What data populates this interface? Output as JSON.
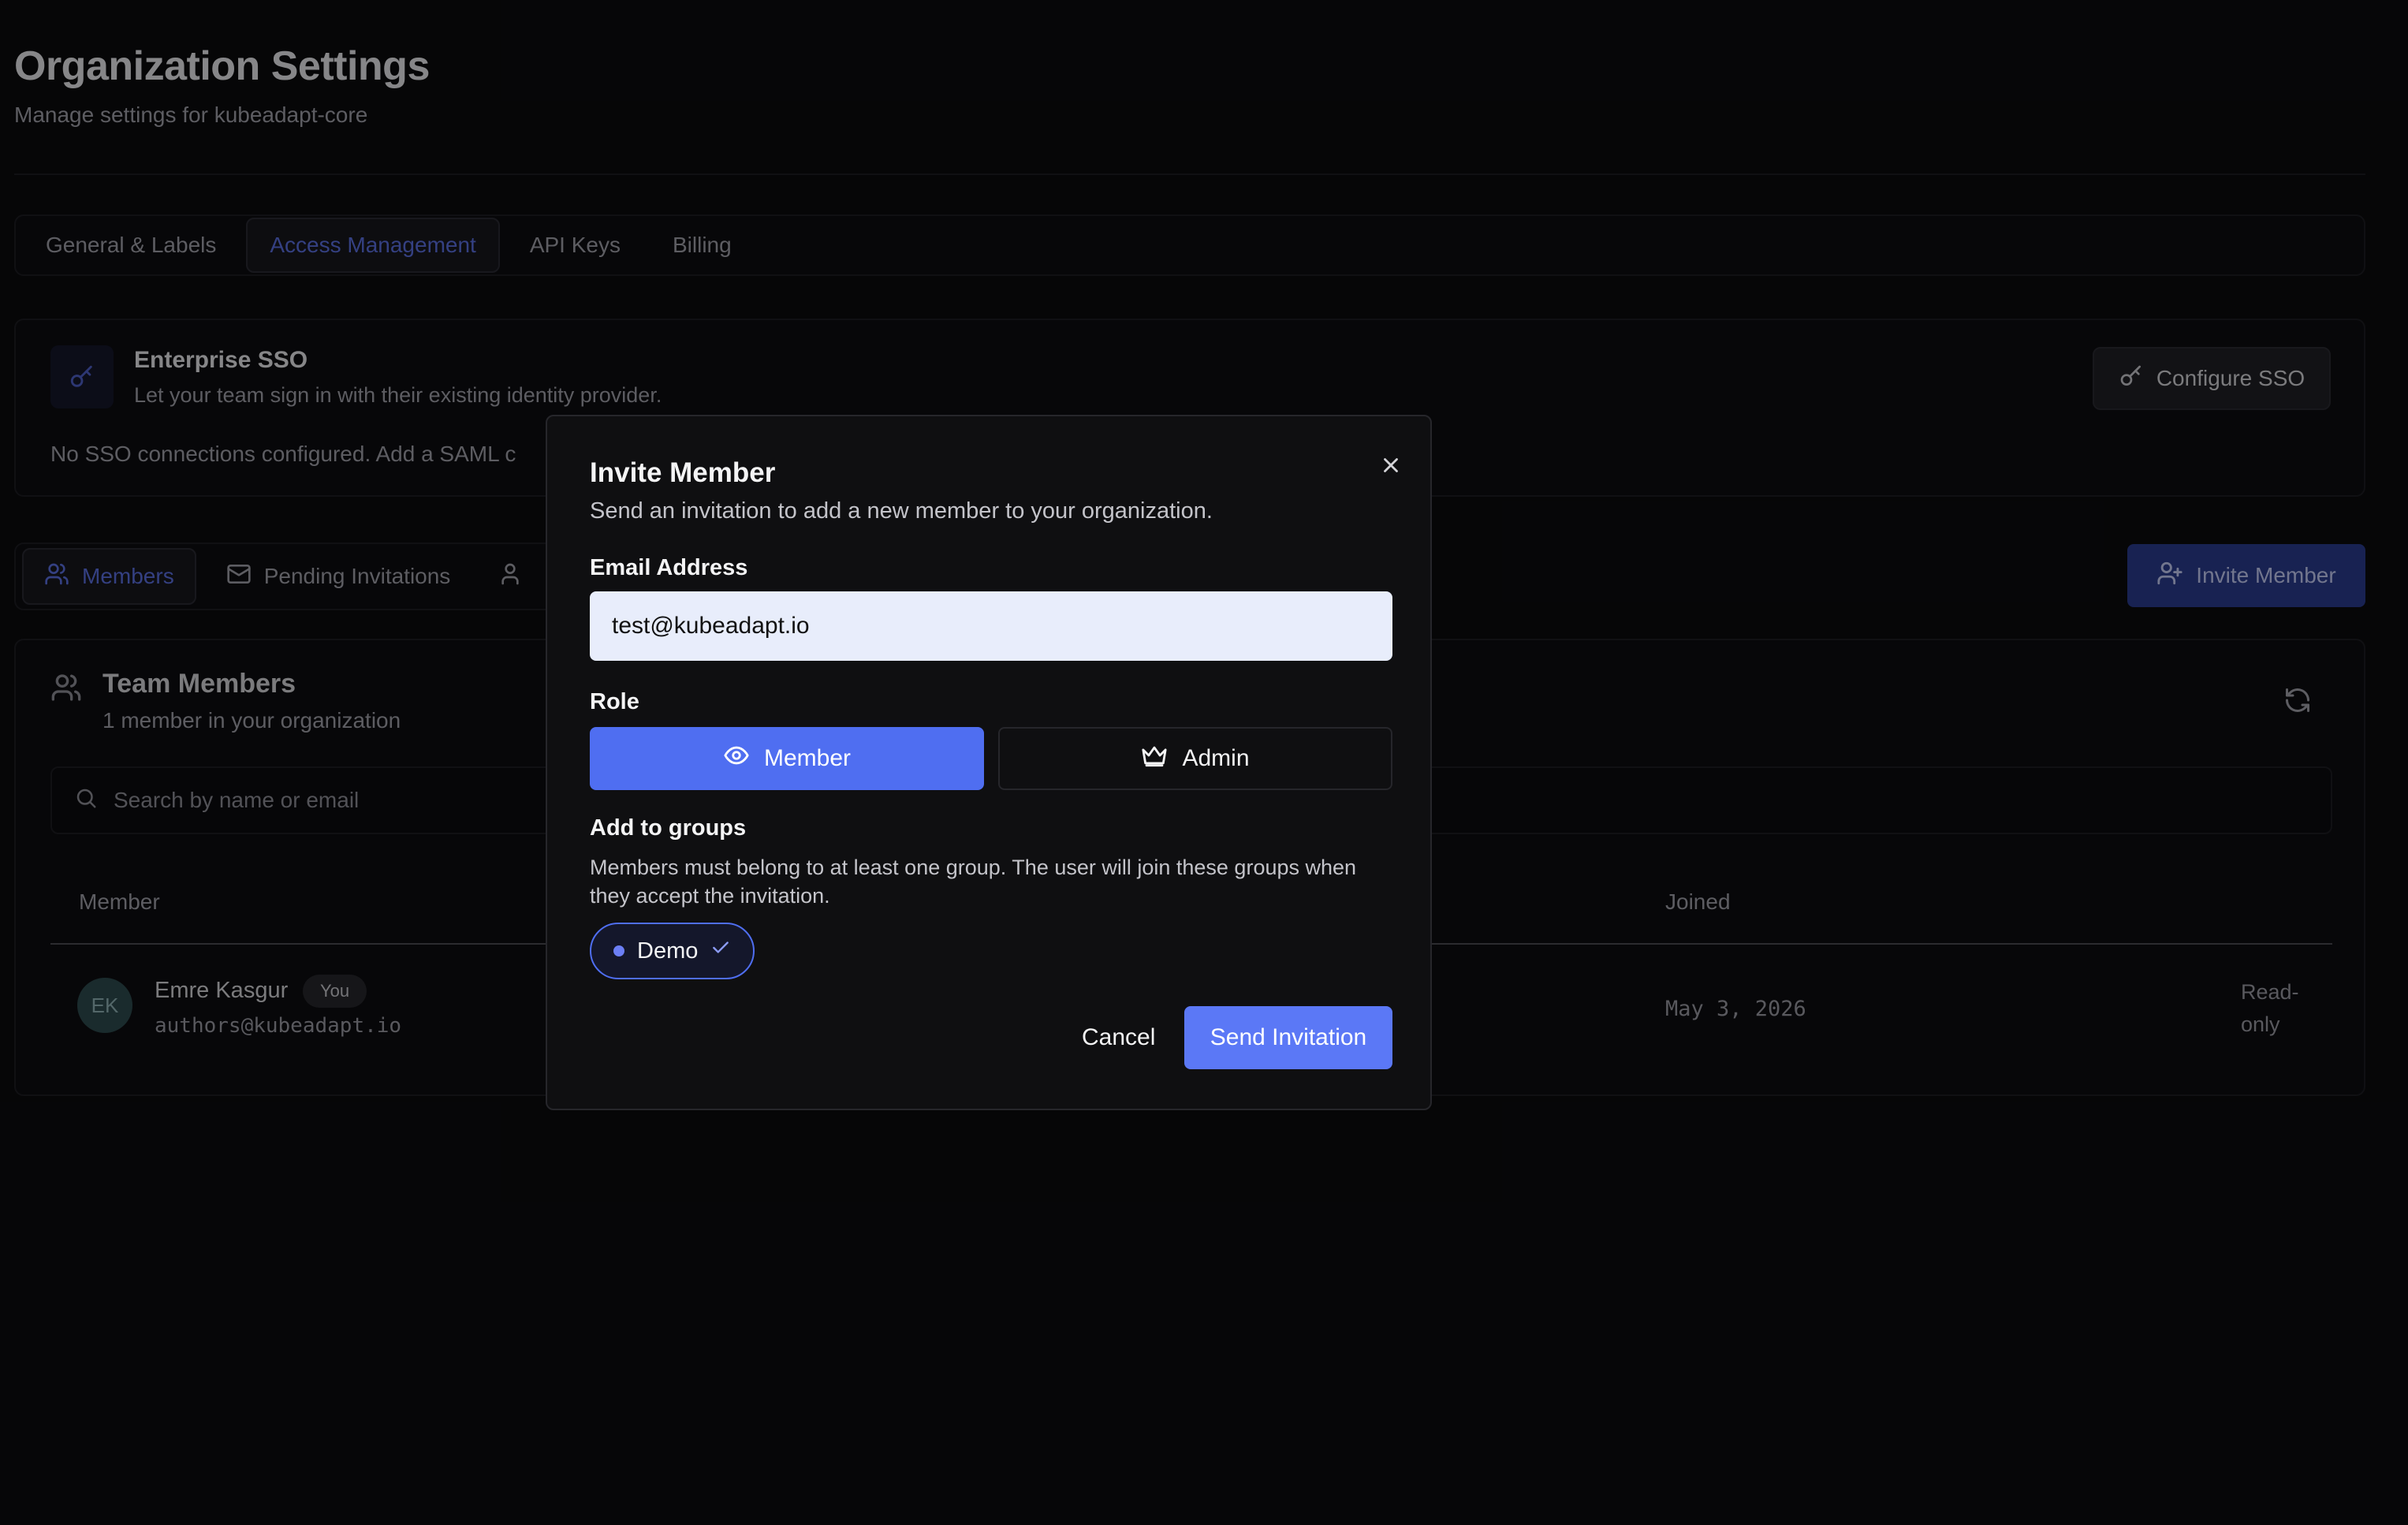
{
  "page": {
    "title": "Organization Settings",
    "subtitle": "Manage settings for kubeadapt-core"
  },
  "tabs": [
    {
      "label": "General & Labels",
      "active": false
    },
    {
      "label": "Access Management",
      "active": true
    },
    {
      "label": "API Keys",
      "active": false
    },
    {
      "label": "Billing",
      "active": false
    }
  ],
  "sso": {
    "title": "Enterprise SSO",
    "description": "Let your team sign in with their existing identity provider.",
    "note": "No SSO connections configured. Add a SAML c",
    "configure_label": "Configure SSO",
    "icon": "key-icon"
  },
  "sub_tabs": [
    {
      "label": "Members",
      "icon": "users-icon",
      "active": true
    },
    {
      "label": "Pending Invitations",
      "icon": "mail-icon",
      "active": false
    }
  ],
  "invite_button_label": "Invite Member",
  "team": {
    "title": "Team Members",
    "subtitle": "1 member in your organization",
    "search_placeholder": "Search by name or email",
    "columns": {
      "member": "Member",
      "joined": "Joined"
    },
    "rows": [
      {
        "initials": "EK",
        "name": "Emre Kasgur",
        "badge": "You",
        "email": "authors@kubeadapt.io",
        "joined": "May 3, 2026",
        "role": "Read-only"
      }
    ]
  },
  "modal": {
    "title": "Invite Member",
    "description": "Send an invitation to add a new member to your organization.",
    "email_label": "Email Address",
    "email_value": "test@kubeadapt.io",
    "role_label": "Role",
    "roles": [
      {
        "label": "Member",
        "icon": "eye-icon",
        "selected": true
      },
      {
        "label": "Admin",
        "icon": "crown-icon",
        "selected": false
      }
    ],
    "groups_label": "Add to groups",
    "groups_help": "Members must belong to at least one group. The user will join these groups when they accept the invitation.",
    "groups": [
      {
        "label": "Demo",
        "selected": true
      }
    ],
    "cancel_label": "Cancel",
    "send_label": "Send Invitation"
  },
  "colors": {
    "accent": "#4f6ef1",
    "background": "#0b0b0d",
    "input_bg": "#e8edfb"
  }
}
